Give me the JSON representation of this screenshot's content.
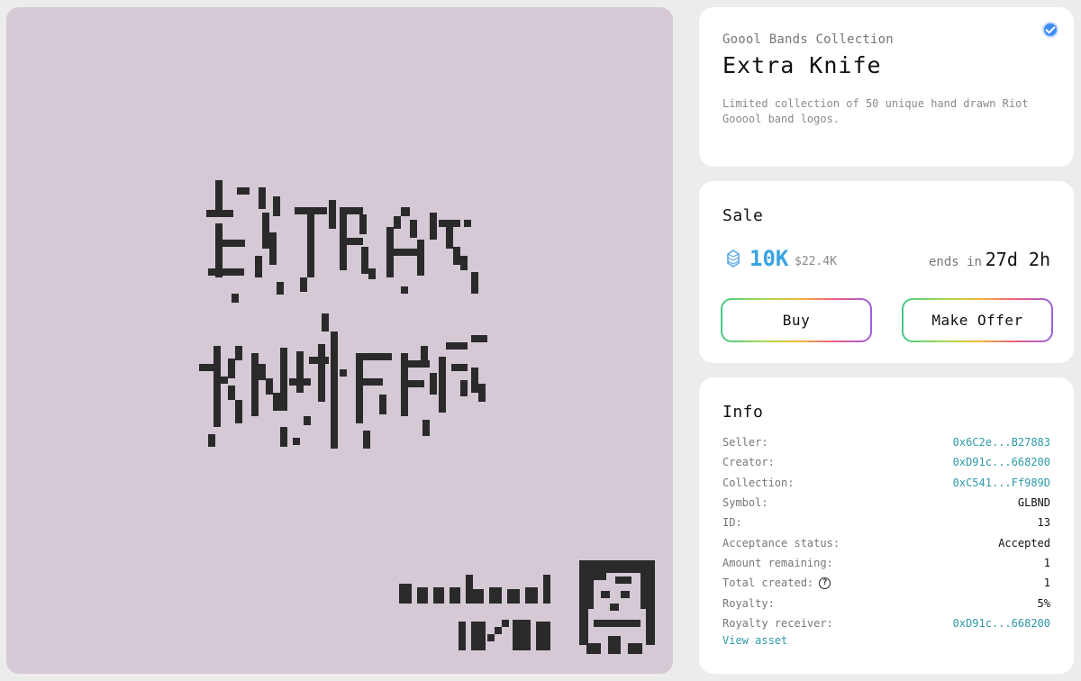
{
  "collection": {
    "name": "Goool Bands Collection",
    "title": "Extra Knife",
    "description": "Limited collection of 50 unique hand drawn Riot Gooool band logos.",
    "verified_icon": "verified-check-icon"
  },
  "sale": {
    "title": "Sale",
    "token_icon": "token-icon",
    "price": "10K",
    "price_usd": "$22.4K",
    "ends_label": "ends in",
    "ends_value": "27d 2h",
    "buy_label": "Buy",
    "offer_label": "Make Offer"
  },
  "info": {
    "title": "Info",
    "rows": [
      {
        "key": "Seller:",
        "value": "0x6C2e...B27883"
      },
      {
        "key": "Creator:",
        "value": "0xD91c...668200"
      },
      {
        "key": "Collection:",
        "value": "0xC541...Ff989D"
      },
      {
        "key": "Symbol:",
        "value": "GLBND"
      },
      {
        "key": "ID:",
        "value": "13"
      },
      {
        "key": "Acceptance status:",
        "value": "Accepted"
      },
      {
        "key": "Amount remaining:",
        "value": "1"
      },
      {
        "key": "Total created:",
        "value": "1"
      },
      {
        "key": "Royalty:",
        "value": "5%"
      },
      {
        "key": "Royalty receiver:",
        "value": "0xD91c...668200"
      }
    ],
    "help_icon": "question-circle-icon",
    "view_asset": "View asset"
  },
  "colors": {
    "art_background": "#d4c9d5",
    "price": "#3aa3e3",
    "link": "#2d9aa8",
    "verified": "#3d8df5"
  }
}
